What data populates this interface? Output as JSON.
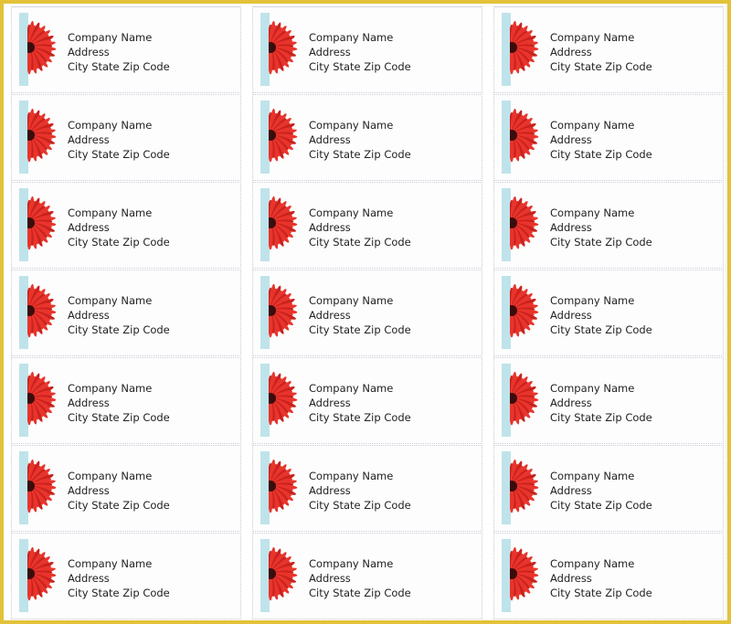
{
  "document": {
    "type": "address-label-sheet",
    "columns": 3,
    "rows": 7,
    "colors": {
      "frame": "#e3c23a",
      "accent_bar": "#bfe3ea",
      "flower": "#e8342c",
      "flower_center": "#3a0d0d"
    }
  },
  "labels": [
    {
      "company": "Company Name",
      "address": "Address",
      "city_line": "City State Zip Code"
    },
    {
      "company": "Company Name",
      "address": "Address",
      "city_line": "City State Zip Code"
    },
    {
      "company": "Company Name",
      "address": "Address",
      "city_line": "City State Zip Code"
    },
    {
      "company": "Company Name",
      "address": "Address",
      "city_line": "City State Zip Code"
    },
    {
      "company": "Company Name",
      "address": "Address",
      "city_line": "City State Zip Code"
    },
    {
      "company": "Company Name",
      "address": "Address",
      "city_line": "City State Zip Code"
    },
    {
      "company": "Company Name",
      "address": "Address",
      "city_line": "City State Zip Code"
    },
    {
      "company": "Company Name",
      "address": "Address",
      "city_line": "City State Zip Code"
    },
    {
      "company": "Company Name",
      "address": "Address",
      "city_line": "City State Zip Code"
    },
    {
      "company": "Company Name",
      "address": "Address",
      "city_line": "City State Zip Code"
    },
    {
      "company": "Company Name",
      "address": "Address",
      "city_line": "City State Zip Code"
    },
    {
      "company": "Company Name",
      "address": "Address",
      "city_line": "City State Zip Code"
    },
    {
      "company": "Company Name",
      "address": "Address",
      "city_line": "City State Zip Code"
    },
    {
      "company": "Company Name",
      "address": "Address",
      "city_line": "City State Zip Code"
    },
    {
      "company": "Company Name",
      "address": "Address",
      "city_line": "City State Zip Code"
    },
    {
      "company": "Company Name",
      "address": "Address",
      "city_line": "City State Zip Code"
    },
    {
      "company": "Company Name",
      "address": "Address",
      "city_line": "City State Zip Code"
    },
    {
      "company": "Company Name",
      "address": "Address",
      "city_line": "City State Zip Code"
    },
    {
      "company": "Company Name",
      "address": "Address",
      "city_line": "City State Zip Code"
    },
    {
      "company": "Company Name",
      "address": "Address",
      "city_line": "City State Zip Code"
    },
    {
      "company": "Company Name",
      "address": "Address",
      "city_line": "City State Zip Code"
    }
  ]
}
